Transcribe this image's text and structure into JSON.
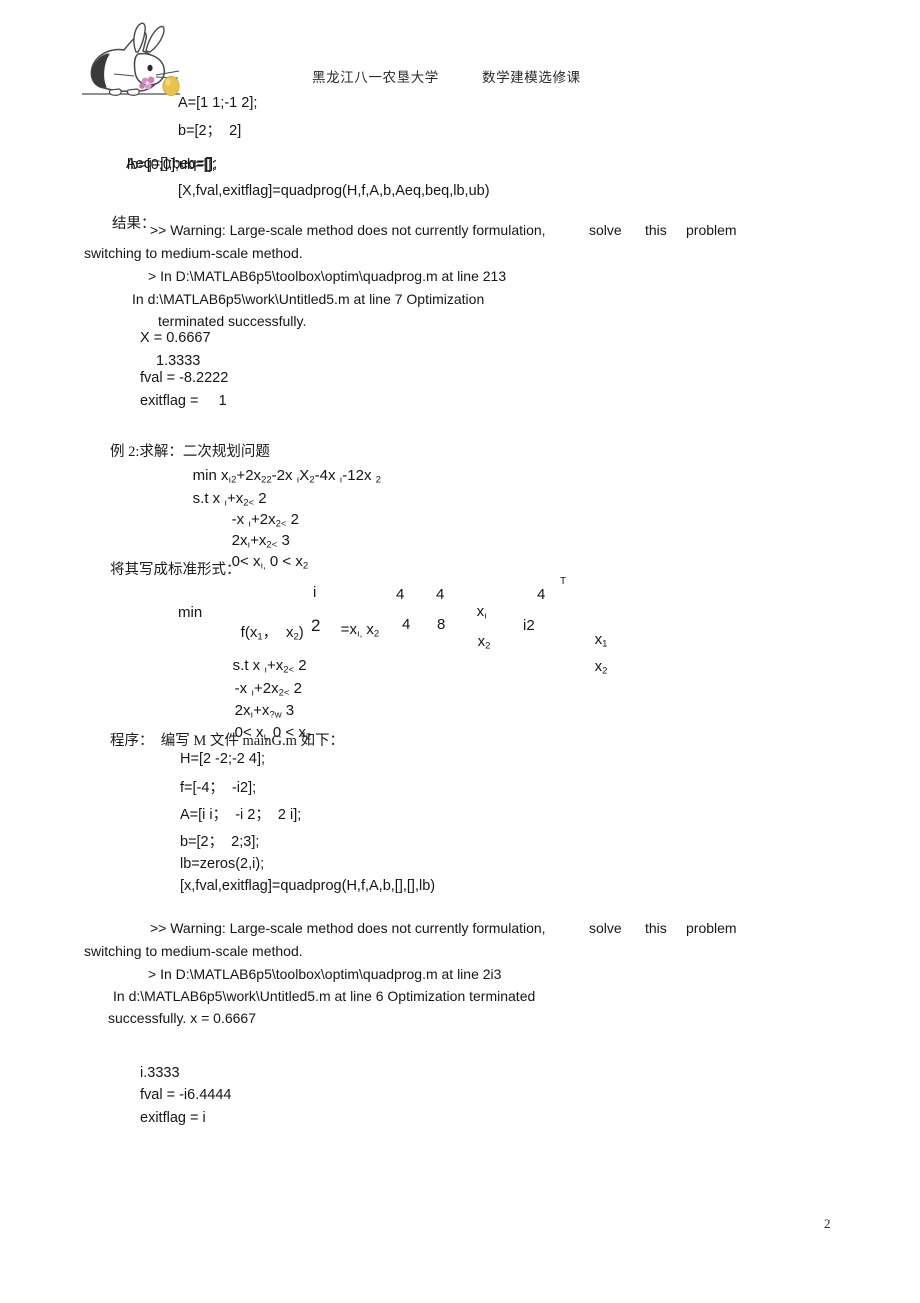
{
  "document": {
    "page_number": "2",
    "header": {
      "university": "黑龙江八一农垦大学",
      "course": "数学建模选修课",
      "logo_alt": "rabbit-logo"
    }
  },
  "example1": {
    "code_lines": [
      "A=[1 1;-1 2];",
      "b=[2；  2]"
    ],
    "overlap_line": {
      "layer_a": "Aeq=[];beq=[];",
      "layer_b": "lb=[0;0];ub=[];"
    },
    "call_line": "[X,fval,exitflag]=quadprog(H,f,A,b,Aeq,beq,lb,ub)",
    "result_label": "结果：",
    "warning_main": ">> Warning: Large-scale method does not currently formulation,",
    "warning_tail_1": "solve",
    "warning_tail_2": "this",
    "warning_tail_3": "problem",
    "warning_cont": "switching to medium-scale method.",
    "trace_1": "> In D:\\MATLAB6p5\\toolbox\\optim\\quadprog.m at line 213",
    "trace_2": "In d:\\MATLAB6p5\\work\\Untitled5.m at line 7 Optimization",
    "trace_3": "terminated successfully.",
    "out_x": "X = 0.6667",
    "out_x2": "1.3333",
    "out_fval": "fval = -8.2222",
    "out_exitflag": "exitflag =     1"
  },
  "example2": {
    "title": "例 2:求解：二次规划问题",
    "objective": {
      "min": "min x",
      "sub_a": "ı2",
      "term_b": "+2x",
      "sub_b": "22",
      "term_c": "-2x",
      "sub_c": "ı",
      "term_d": "X",
      "sub_d": "2",
      "term_e": "-4x",
      "sub_e": "ı",
      "term_f": "-12x",
      "sub_f": "2"
    },
    "constraints": [
      {
        "head": "s.t x",
        "s1": "ı",
        "mid": "+x",
        "s2": "2<",
        "rhs": "2"
      },
      {
        "head": "-x",
        "s1": "ı",
        "mid": "+2x",
        "s2": "2<",
        "rhs": "2"
      },
      {
        "head": "2x",
        "s1": "ı",
        "mid": "+x",
        "s2": "2<",
        "rhs": "3"
      },
      {
        "head": "0< x",
        "s1": "ı,",
        "mid": " 0 < x",
        "s2": "2",
        "rhs": ""
      }
    ],
    "standard_form_label": "将其写成标准形式：",
    "matrix_block": {
      "min_label": "min",
      "fx_label": "f(x",
      "fx_sub1": "1",
      "fx_mid": "，  x",
      "fx_sub2": "2",
      "fx_close": ")",
      "equals": "=",
      "vec_row": "x",
      "vec_row_sub": "ı,",
      "vec_row2": " x",
      "vec_row2_sub": "2",
      "frac_num": "i",
      "frac_den": "2",
      "m11": "4",
      "m12": "4",
      "v1": "x",
      "v1_sub": "ı",
      "m21": "4",
      "m22": "8",
      "v2": "x",
      "v2_sub": "2",
      "c1": "4",
      "c2": "i2",
      "transpose": "T",
      "tx1": "x",
      "tx1_sub": "1",
      "tx2": "x",
      "tx2_sub": "2"
    },
    "constraints2": [
      {
        "head": "s.t x",
        "s1": "ı",
        "mid": "+x",
        "s2": "2<",
        "rhs": "2"
      },
      {
        "head": "-x",
        "s1": "ı",
        "mid": "+2x",
        "s2": "2<",
        "rhs": "2"
      },
      {
        "head": "2x",
        "s1": "ı",
        "mid": "+x",
        "s2": "?w",
        "rhs": "3"
      },
      {
        "head": "0< x",
        "s1": "ı,",
        "mid": " 0 < x",
        "s2": "2",
        "rhs": ""
      }
    ],
    "program_label": "程序：  编写 M 文件 mainG.m 如下：",
    "code_lines": [
      "H=[2 -2;-2 4];",
      "f=[-4；  -i2];",
      "A=[i i；  -i 2；  2 i];",
      "b=[2；  2;3];",
      "lb=zeros(2,i);",
      "[x,fval,exitflag]=quadprog(H,f,A,b,[],[],lb)"
    ],
    "warning_main": ">> Warning: Large-scale method does not currently formulation,",
    "warning_tail_1": "solve",
    "warning_tail_2": "this",
    "warning_tail_3": "problem",
    "warning_cont": "switching to medium-scale method.",
    "trace_1": "> In D:\\MATLAB6p5\\toolbox\\optim\\quadprog.m at line 2i3",
    "trace_2": "In d:\\MATLAB6p5\\work\\Untitled5.m at line 6 Optimization terminated",
    "trace_3": "successfully. x = 0.6667",
    "out_x2": "i.3333",
    "out_fval": "fval = -i6.4444",
    "out_exitflag": "exitflag = i"
  }
}
